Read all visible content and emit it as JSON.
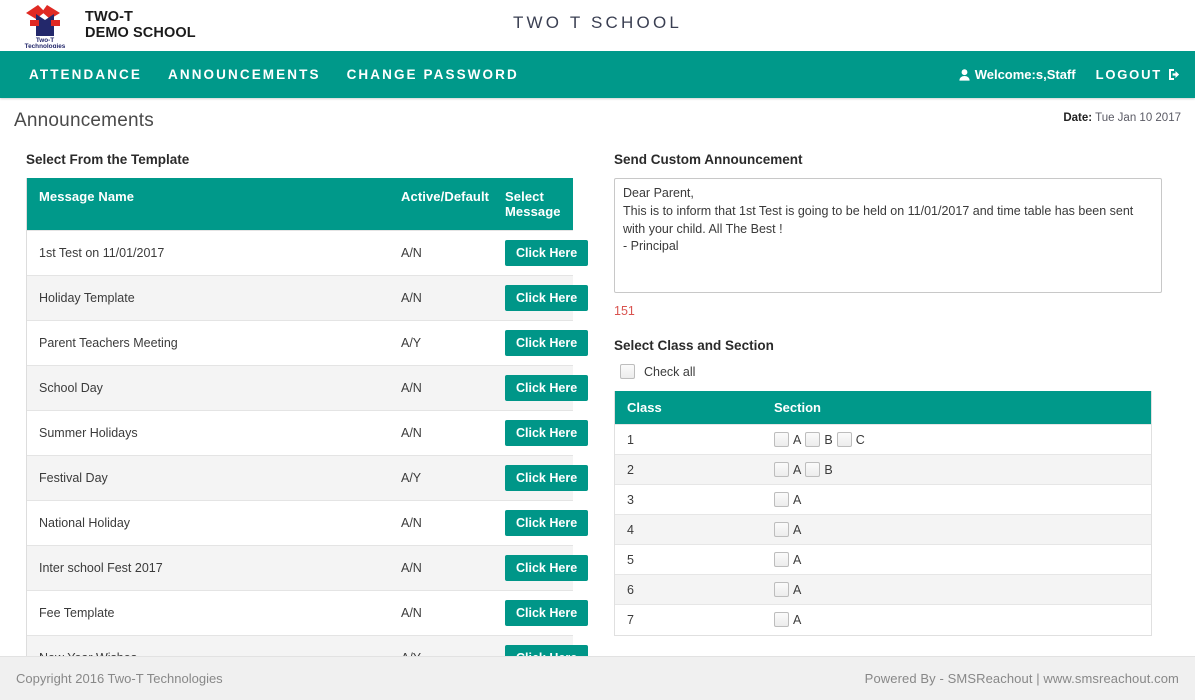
{
  "brand": {
    "logo_line1": "TWO-T",
    "logo_line2": "DEMO SCHOOL",
    "logo_caption1": "Two-T",
    "logo_caption2": "Technologies",
    "school_title": "TWO T SCHOOL"
  },
  "nav": {
    "items": [
      {
        "label": "ATTENDANCE"
      },
      {
        "label": "ANNOUNCEMENTS"
      },
      {
        "label": "CHANGE PASSWORD"
      }
    ],
    "welcome": "Welcome:s,Staff",
    "logout": "LOGOUT"
  },
  "page": {
    "title": "Announcements",
    "date_label": "Date:",
    "date_value": " Tue Jan 10 2017"
  },
  "template_panel": {
    "heading": "Select From the Template",
    "columns": {
      "name": "Message Name",
      "active_default": "Active/Default",
      "select_message": "Select Message",
      "select_message_l1": "Select",
      "select_message_l2": "Message"
    },
    "button_label": "Click Here",
    "rows": [
      {
        "name": "1st Test on 11/01/2017",
        "active_default": "A/N",
        "action": "Click Here"
      },
      {
        "name": "Holiday Template",
        "active_default": "A/N",
        "action": "Click Here"
      },
      {
        "name": "Parent Teachers Meeting",
        "active_default": "A/Y",
        "action": "Click Here"
      },
      {
        "name": "School Day",
        "active_default": "A/N",
        "action": "Click Here"
      },
      {
        "name": "Summer Holidays",
        "active_default": "A/N",
        "action": "Click Here"
      },
      {
        "name": "Festival Day",
        "active_default": "A/Y",
        "action": "Click Here"
      },
      {
        "name": "National Holiday",
        "active_default": "A/N",
        "action": "Click Here"
      },
      {
        "name": "Inter school Fest 2017",
        "active_default": "A/N",
        "action": "Click Here"
      },
      {
        "name": "Fee Template",
        "active_default": "A/N",
        "action": "Click Here"
      },
      {
        "name": "New Year Wishes",
        "active_default": "A/Y",
        "action": "Click Here"
      }
    ]
  },
  "custom_panel": {
    "heading": "Send Custom Announcement",
    "message_value": "Dear Parent,\nThis is to inform that 1st Test is going to be held on 11/01/2017 and time table has been sent with your child. All The Best !\n- Principal",
    "message_placeholder": "",
    "char_count": "151"
  },
  "class_panel": {
    "heading": "Select Class and Section",
    "check_all_label": "Check all",
    "columns": {
      "class": "Class",
      "section": "Section"
    },
    "rows": [
      {
        "class": "1",
        "sections": [
          "A",
          "B",
          "C"
        ]
      },
      {
        "class": "2",
        "sections": [
          "A",
          "B"
        ]
      },
      {
        "class": "3",
        "sections": [
          "A"
        ]
      },
      {
        "class": "4",
        "sections": [
          "A"
        ]
      },
      {
        "class": "5",
        "sections": [
          "A"
        ]
      },
      {
        "class": "6",
        "sections": [
          "A"
        ]
      },
      {
        "class": "7",
        "sections": [
          "A"
        ]
      }
    ]
  },
  "footer": {
    "copyright": "Copyright 2016 Two-T Technologies",
    "powered_by": "Powered By - SMSReachout  |  www.smsreachout.com"
  },
  "colors": {
    "teal": "#00998a",
    "button_teal": "#009688",
    "count_red": "#d9534f",
    "logo_red": "#e02a23",
    "logo_navy": "#23286b"
  }
}
